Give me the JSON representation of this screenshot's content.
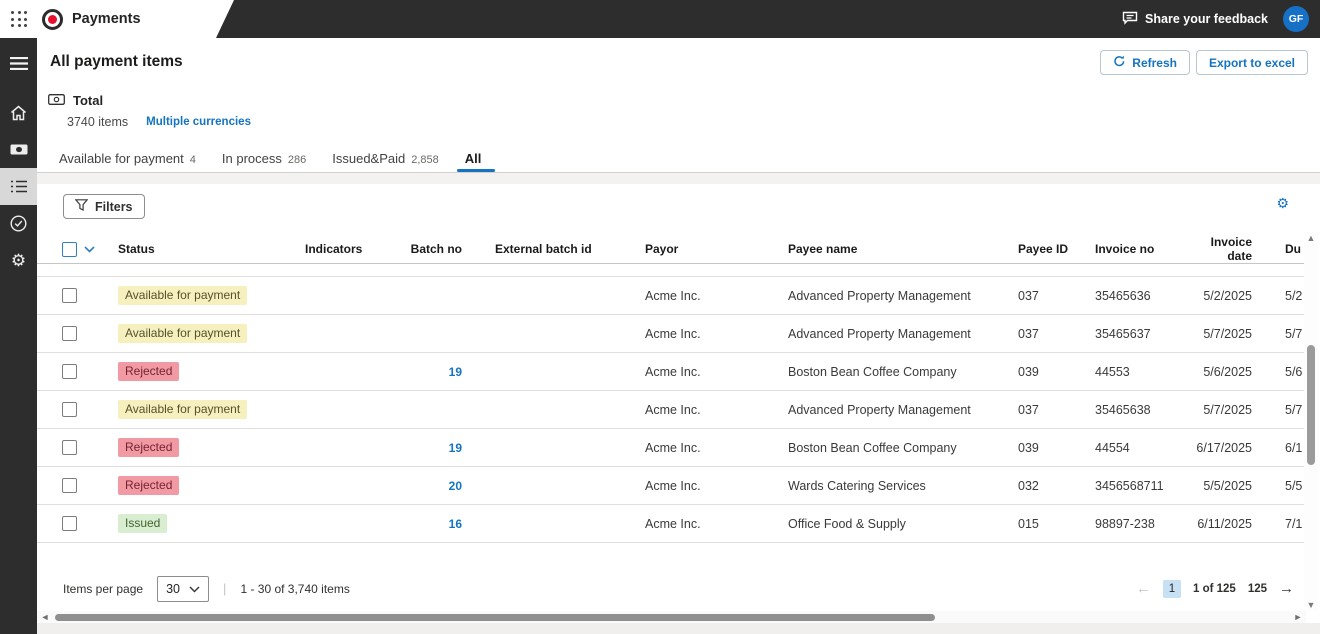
{
  "topbar": {
    "app_title": "Payments",
    "feedback_label": "Share your feedback",
    "avatar_initials": "GF"
  },
  "sidebar": {
    "items": [
      {
        "icon": "hamburger-menu-icon"
      },
      {
        "icon": "home-icon"
      },
      {
        "icon": "banknote-icon"
      },
      {
        "icon": "list-icon",
        "selected": true
      },
      {
        "icon": "check-circle-icon"
      },
      {
        "icon": "gear-icon"
      }
    ]
  },
  "page": {
    "title": "All payment items",
    "refresh_label": "Refresh",
    "export_label": "Export to excel"
  },
  "summary": {
    "label": "Total",
    "count": "3740 items",
    "currencies_link": "Multiple currencies"
  },
  "tabs": [
    {
      "label": "Available for payment",
      "count": "4"
    },
    {
      "label": "In process",
      "count": "286"
    },
    {
      "label": "Issued&Paid",
      "count": "2,858"
    },
    {
      "label": "All",
      "count": ""
    }
  ],
  "toolbar": {
    "filters_label": "Filters"
  },
  "table": {
    "columns": [
      "Status",
      "Indicators",
      "Batch no",
      "External batch id",
      "Payor",
      "Payee name",
      "Payee ID",
      "Invoice no",
      "Invoice date",
      "Du"
    ],
    "rows": [
      {
        "status": "Available for payment",
        "status_type": "available",
        "indicators": "",
        "batch_no": "",
        "external_batch_id": "",
        "payor": "Acme Inc.",
        "payee_name": "Advanced Property Management",
        "payee_id": "037",
        "invoice_no": "35465636",
        "invoice_date": "5/2/2025",
        "due": "5/2"
      },
      {
        "status": "Available for payment",
        "status_type": "available",
        "indicators": "",
        "batch_no": "",
        "external_batch_id": "",
        "payor": "Acme Inc.",
        "payee_name": "Advanced Property Management",
        "payee_id": "037",
        "invoice_no": "35465637",
        "invoice_date": "5/7/2025",
        "due": "5/7"
      },
      {
        "status": "Rejected",
        "status_type": "rejected",
        "indicators": "",
        "batch_no": "19",
        "external_batch_id": "",
        "payor": "Acme Inc.",
        "payee_name": "Boston Bean Coffee Company",
        "payee_id": "039",
        "invoice_no": "44553",
        "invoice_date": "5/6/2025",
        "due": "5/6"
      },
      {
        "status": "Available for payment",
        "status_type": "available",
        "indicators": "",
        "batch_no": "",
        "external_batch_id": "",
        "payor": "Acme Inc.",
        "payee_name": "Advanced Property Management",
        "payee_id": "037",
        "invoice_no": "35465638",
        "invoice_date": "5/7/2025",
        "due": "5/7"
      },
      {
        "status": "Rejected",
        "status_type": "rejected",
        "indicators": "",
        "batch_no": "19",
        "external_batch_id": "",
        "payor": "Acme Inc.",
        "payee_name": "Boston Bean Coffee Company",
        "payee_id": "039",
        "invoice_no": "44554",
        "invoice_date": "6/17/2025",
        "due": "6/1"
      },
      {
        "status": "Rejected",
        "status_type": "rejected",
        "indicators": "",
        "batch_no": "20",
        "external_batch_id": "",
        "payor": "Acme Inc.",
        "payee_name": "Wards Catering Services",
        "payee_id": "032",
        "invoice_no": "3456568711",
        "invoice_date": "5/5/2025",
        "due": "5/5"
      },
      {
        "status": "Issued",
        "status_type": "issued",
        "indicators": "",
        "batch_no": "16",
        "external_batch_id": "",
        "payor": "Acme Inc.",
        "payee_name": "Office Food & Supply",
        "payee_id": "015",
        "invoice_no": "98897-238",
        "invoice_date": "6/11/2025",
        "due": "7/1"
      }
    ]
  },
  "pagination": {
    "items_per_page_label": "Items per page",
    "page_size": "30",
    "range_text": "1 - 30 of 3,740 items",
    "current_page": "1",
    "page_info": "1 of 125",
    "last_page": "125"
  },
  "glyphs": {
    "gear": "⚙",
    "pipe": "|",
    "prev_arrow": "←",
    "next_arrow": "→",
    "tri_up": "▲",
    "tri_down": "▼",
    "tri_left": "◄",
    "tri_right": "►"
  },
  "colors": {
    "accent": "#1574bf",
    "topbar-bg": "#2d2d2d",
    "avatar-bg": "#1570c6",
    "logo-red": "#e8112d",
    "badge-available-bg": "#f6f0be",
    "badge-available-text": "#56502e",
    "badge-rejected-bg": "#f19aa3",
    "badge-rejected-text": "#732430",
    "badge-issued-bg": "#d9eed0",
    "badge-issued-text": "#42632f"
  }
}
